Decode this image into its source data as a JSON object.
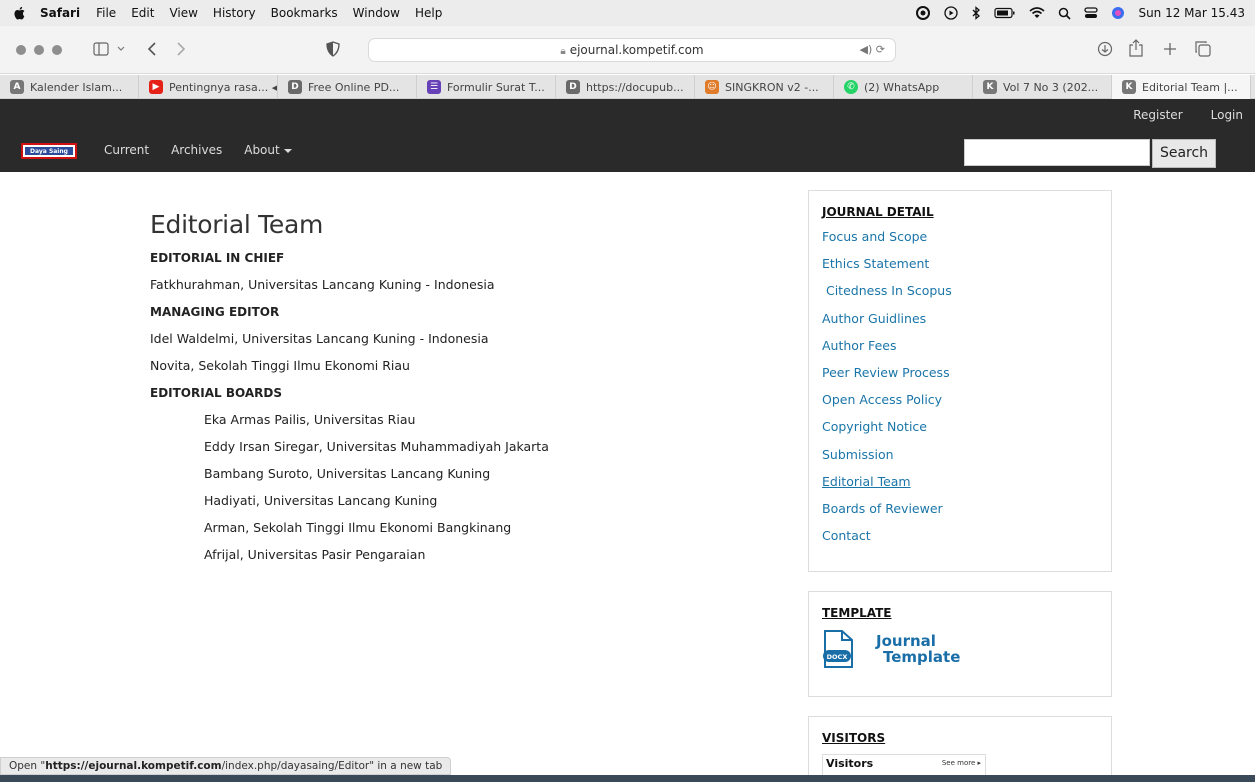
{
  "menubar": {
    "app": "Safari",
    "items": [
      "File",
      "Edit",
      "View",
      "History",
      "Bookmarks",
      "Window",
      "Help"
    ],
    "clock": "Sun 12 Mar 15.43"
  },
  "toolbar": {
    "url": "ejournal.kompetif.com"
  },
  "tabs": [
    {
      "label": "Kalender Islam...",
      "fav": "A",
      "color": "#777777"
    },
    {
      "label": "Pentingnya rasa... ◀︎))",
      "fav": "▶",
      "color": "#e62117"
    },
    {
      "label": "Free Online PD...",
      "fav": "D",
      "color": "#6a6a6a"
    },
    {
      "label": "Formulir Surat T...",
      "fav": "☰",
      "color": "#6741b7"
    },
    {
      "label": "https://docupub...",
      "fav": "D",
      "color": "#6a6a6a"
    },
    {
      "label": "SINGKRON v2 -...",
      "fav": "☺",
      "color": "#e07b2a"
    },
    {
      "label": "(2) WhatsApp",
      "fav": "✆",
      "color": "#25d366"
    },
    {
      "label": "Vol 7 No 3 (202...",
      "fav": "K",
      "color": "#777777"
    },
    {
      "label": "Editorial Team |...",
      "fav": "K",
      "color": "#777777"
    }
  ],
  "sitenav": {
    "register": "Register",
    "login": "Login",
    "logo_text": "Daya Saing",
    "links": [
      "Current",
      "Archives",
      "About"
    ],
    "search_button": "Search"
  },
  "main": {
    "title": "Editorial Team",
    "chief_title": "EDITORIAL IN CHIEF",
    "chief": [
      "Fatkhurahman, Universitas Lancang Kuning - Indonesia"
    ],
    "managing_title": "MANAGING EDITOR",
    "managing": [
      "Idel Waldelmi, Universitas Lancang Kuning - Indonesia",
      "Novita, Sekolah Tinggi Ilmu Ekonomi Riau"
    ],
    "boards_title": "EDITORIAL BOARDS",
    "boards": [
      "Eka Armas Pailis, Universitas Riau",
      "Eddy Irsan Siregar, Universitas Muhammadiyah Jakarta",
      "Bambang Suroto, Universitas Lancang Kuning",
      "Hadiyati, Universitas Lancang Kuning",
      "Arman, Sekolah Tinggi Ilmu Ekonomi Bangkinang",
      "Afrijal, Universitas Pasir Pengaraian"
    ]
  },
  "sidebar": {
    "journal_title": "JOURNAL DETAIL",
    "links": [
      "Focus and Scope",
      "Ethics Statement",
      " Citedness In Scopus",
      "Author Guidlines",
      "Author Fees",
      "Peer Review Process",
      "Open Access Policy",
      "Copyright Notice",
      "Submission",
      "Editorial Team",
      "Boards of Reviewer",
      "Contact"
    ],
    "template_title": "TEMPLATE",
    "template_badge": "DOCX",
    "template_line1": "Journal",
    "template_line2": "Template",
    "visitors_title": "VISITORS",
    "visitors_widget_title": "Visitors",
    "visitors_more": "See more ▸"
  },
  "status": {
    "prefix": "Open \"",
    "host": "https://ejournal.kompetif.com",
    "path": "/index.php/dayasaing/Editor",
    "suffix": "\" in a new tab"
  }
}
